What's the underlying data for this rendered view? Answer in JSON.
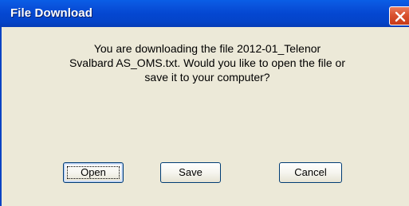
{
  "window": {
    "title": "File Download"
  },
  "dialog": {
    "message_lines": [
      "You are downloading the file 2012-01_Telenor",
      "Svalbard AS_OMS.txt.  Would you like to open the file or",
      "save it to your computer?"
    ]
  },
  "buttons": {
    "open_label": "Open",
    "save_label": "Save",
    "cancel_label": "Cancel"
  },
  "icons": {
    "close": "close-icon"
  },
  "colors": {
    "titlebar": "#0447d1",
    "close_button": "#d9512f",
    "dialog_background": "#ece9d8",
    "button_border": "#003c74"
  }
}
